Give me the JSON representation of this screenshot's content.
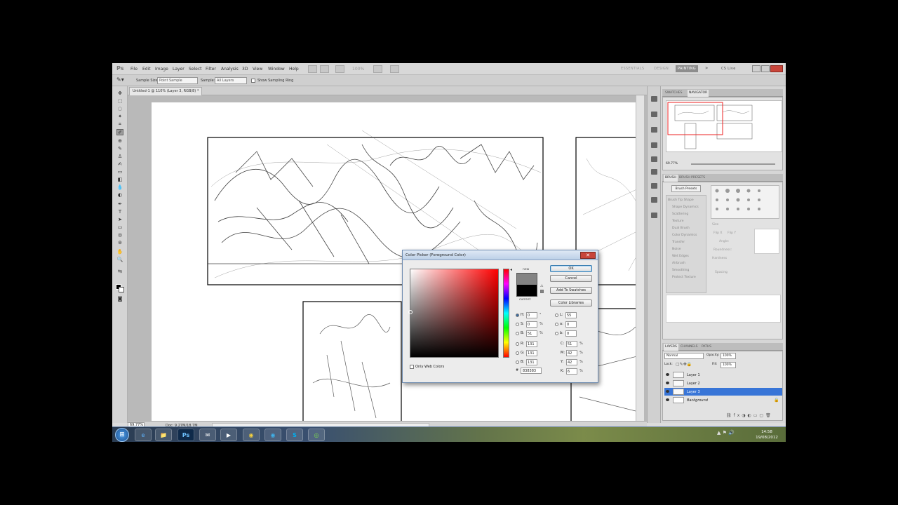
{
  "app": {
    "logo": "Ps",
    "menus": [
      "File",
      "Edit",
      "Image",
      "Layer",
      "Select",
      "Filter",
      "Analysis",
      "3D",
      "View",
      "Window",
      "Help"
    ],
    "zoom_select": "100%",
    "workspaces": [
      "ESSENTIALS",
      "DESIGN",
      "PAINTING"
    ],
    "workspace_more": "»",
    "cs_live": "CS Live"
  },
  "options_bar": {
    "sample_size_label": "Sample Size:",
    "sample_size_value": "Point Sample",
    "sample_label": "Sample:",
    "sample_value": "All Layers",
    "show_ring_label": "Show Sampling Ring"
  },
  "document": {
    "tab_title": "Untitled-1 @ 110% (Layer 3, RGB/8) *",
    "zoom": "69.77%",
    "doc_info": "Doc: 9.27M/18.7M"
  },
  "panels": {
    "top_tabs": [
      "SWATCHES",
      "NAVIGATOR"
    ],
    "navigator_zoom": "69.77%",
    "brush_tabs": [
      "BRUSH",
      "BRUSH PRESETS"
    ],
    "brush_presets_button": "Brush Presets",
    "brush_options": [
      "Brush Tip Shape",
      "Shape Dynamics",
      "Scattering",
      "Texture",
      "Dual Brush",
      "Color Dynamics",
      "Transfer",
      "Noise",
      "Wet Edges",
      "Airbrush",
      "Smoothing",
      "Protect Texture"
    ],
    "brush_size_label": "Size",
    "flip_x": "Flip X",
    "flip_y": "Flip Y",
    "angle": "Angle:",
    "roundness": "Roundness:",
    "hardness": "Hardness",
    "spacing": "Spacing",
    "layers_tabs": [
      "LAYERS",
      "CHANNELS",
      "PATHS"
    ],
    "blend_mode": "Normal",
    "opacity_label": "Opacity:",
    "opacity_value": "100%",
    "lock_label": "Lock:",
    "fill_label": "Fill:",
    "fill_value": "100%",
    "layers": [
      {
        "name": "Layer 1",
        "selected": false
      },
      {
        "name": "Layer 2",
        "selected": false
      },
      {
        "name": "Layer 3",
        "selected": true
      },
      {
        "name": "Background",
        "selected": false
      }
    ]
  },
  "color_picker": {
    "title": "Color Picker (Foreground Color)",
    "close": "✕",
    "new_label": "new",
    "current_label": "current",
    "ok": "OK",
    "cancel": "Cancel",
    "add_to_swatches": "Add To Swatches",
    "color_libraries": "Color Libraries",
    "hsb": [
      {
        "k": "H:",
        "v": "0",
        "u": "°",
        "on": true
      },
      {
        "k": "S:",
        "v": "0",
        "u": "%",
        "on": false
      },
      {
        "k": "B:",
        "v": "51",
        "u": "%",
        "on": false
      }
    ],
    "rgb": [
      {
        "k": "R:",
        "v": "131"
      },
      {
        "k": "G:",
        "v": "131"
      },
      {
        "k": "B:",
        "v": "131"
      }
    ],
    "lab": [
      {
        "k": "L:",
        "v": "55"
      },
      {
        "k": "a:",
        "v": "0"
      },
      {
        "k": "b:",
        "v": "0"
      }
    ],
    "cmyk": [
      {
        "k": "C:",
        "v": "51",
        "u": "%"
      },
      {
        "k": "M:",
        "v": "42",
        "u": "%"
      },
      {
        "k": "Y:",
        "v": "42",
        "u": "%"
      },
      {
        "k": "K:",
        "v": "6",
        "u": "%"
      }
    ],
    "only_web_colors": "Only Web Colors",
    "hex_label": "#",
    "hex": "838383",
    "new_color": "#838383",
    "current_color": "#000000"
  },
  "taskbar": {
    "start_icon": "windows-orb",
    "apps": [
      "e",
      "📁",
      "Ps",
      "✉",
      "▶",
      "◉",
      "S",
      "◎"
    ],
    "tray": "▲ ⚑ 🔊",
    "time": "14:58",
    "date": "19/08/2012"
  }
}
